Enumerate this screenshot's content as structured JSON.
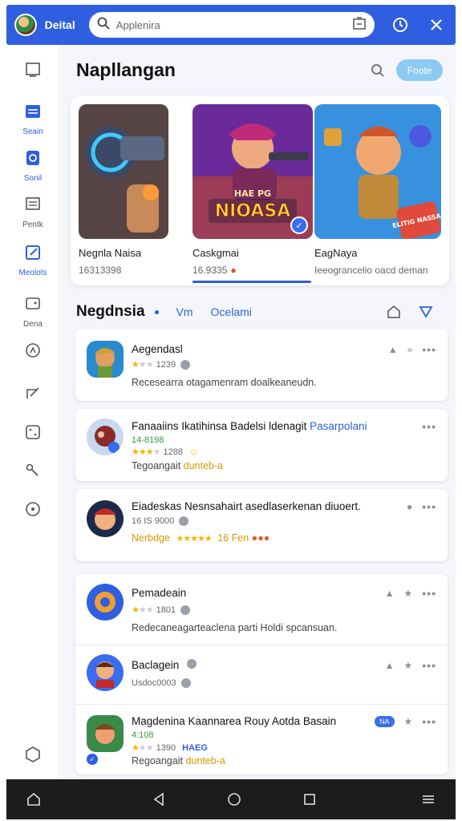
{
  "topbar": {
    "app_name": "Deital",
    "search_placeholder": "Applenira"
  },
  "rail": {
    "items": [
      {
        "label": ""
      },
      {
        "label": "Seain"
      },
      {
        "label": "Sonil"
      },
      {
        "label": "Pentk"
      },
      {
        "label": "Meolots"
      },
      {
        "label": "Dena"
      }
    ]
  },
  "main": {
    "title": "Napllangan",
    "pill_button": "Foote",
    "featured": [
      {
        "name": "Negnla Naisa",
        "meta": "16313398"
      },
      {
        "name": "Caskgmai",
        "meta": "16.9335"
      },
      {
        "name": "EagNaya",
        "meta": "Ieeograncelio oacd deman"
      }
    ],
    "art_text": {
      "title": "NIOASA",
      "sub": "HAE PG",
      "badge": "ELITIG NASSA"
    },
    "section": {
      "title": "Negdnsia",
      "filter_1": "Vm",
      "filter_2": "Ocelami"
    },
    "list": [
      {
        "title": "Aegendasl",
        "rating": "1239",
        "desc": "Recesearra otagamenram doalkeaneudn."
      },
      {
        "title": "Fanaaiins Ikatihinsa Badelsi ldenagit",
        "title_accent": "Pasarpolani",
        "rating_code": "14-8198",
        "rating": "1288",
        "desc": "Tegoangait",
        "desc_accent": "dunteb-a"
      },
      {
        "title": "Eiadeskas Nesnsahairt asedlaserkenan diuoert.",
        "rating_code": "16 IS 9000",
        "desc": "Nerbdge",
        "desc_accent": "16 Fen"
      },
      {
        "title": "Pemadeain",
        "rating": "1801",
        "desc": "Redecaneagarteaclena parti Holdi spcansuan."
      },
      {
        "title": "Baclagein",
        "desc": "Usdoc0003"
      },
      {
        "title": "Magdenina Kaannarea Rouy Aotda Basain",
        "tag": "NA",
        "rating_code": "4:108",
        "rating": "1390",
        "rating_accent": "HAEG",
        "desc": "Regoangait",
        "desc_accent": "dunteb-a"
      }
    ]
  },
  "colors": {
    "brand": "#2f5fe0",
    "star": "#f5b400",
    "bottom_nav": "#1c1c1e"
  }
}
